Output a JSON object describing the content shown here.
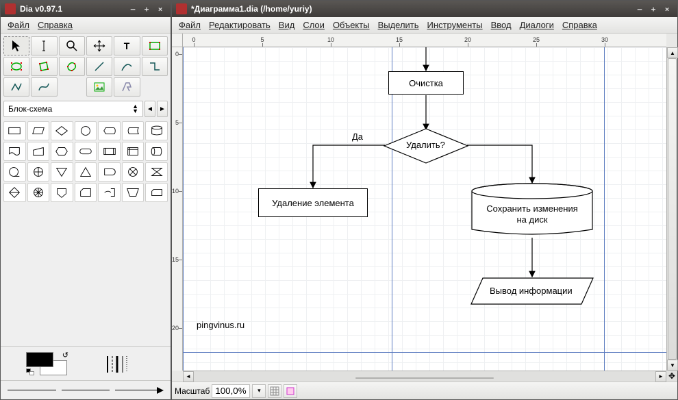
{
  "toolbox": {
    "title": "Dia v0.97.1",
    "menu": {
      "file": "Файл",
      "help": "Справка"
    },
    "sheet": "Блок-схема"
  },
  "canvas": {
    "title": "*Диаграмма1.dia (/home/yuriy)",
    "menu": {
      "file": "Файл",
      "edit": "Редактировать",
      "view": "Вид",
      "layers": "Слои",
      "objects": "Объекты",
      "select": "Выделить",
      "tools": "Инструменты",
      "input": "Ввод",
      "dialogs": "Диалоги",
      "help": "Справка"
    },
    "hruler": [
      0,
      5,
      10,
      15,
      20,
      25,
      30
    ],
    "vruler": [
      0,
      5,
      10,
      15,
      20
    ],
    "status": {
      "zoom_label": "Масштаб",
      "zoom_value": "100,0%"
    },
    "diagram": {
      "box_clear": "Очистка",
      "decision": "Удалить?",
      "yes_label": "Да",
      "box_del": "Удаление элемента",
      "cyl_save_l1": "Сохранить изменения",
      "cyl_save_l2": "на диск",
      "para_out": "Вывод информации",
      "watermark": "pingvinus.ru"
    }
  }
}
